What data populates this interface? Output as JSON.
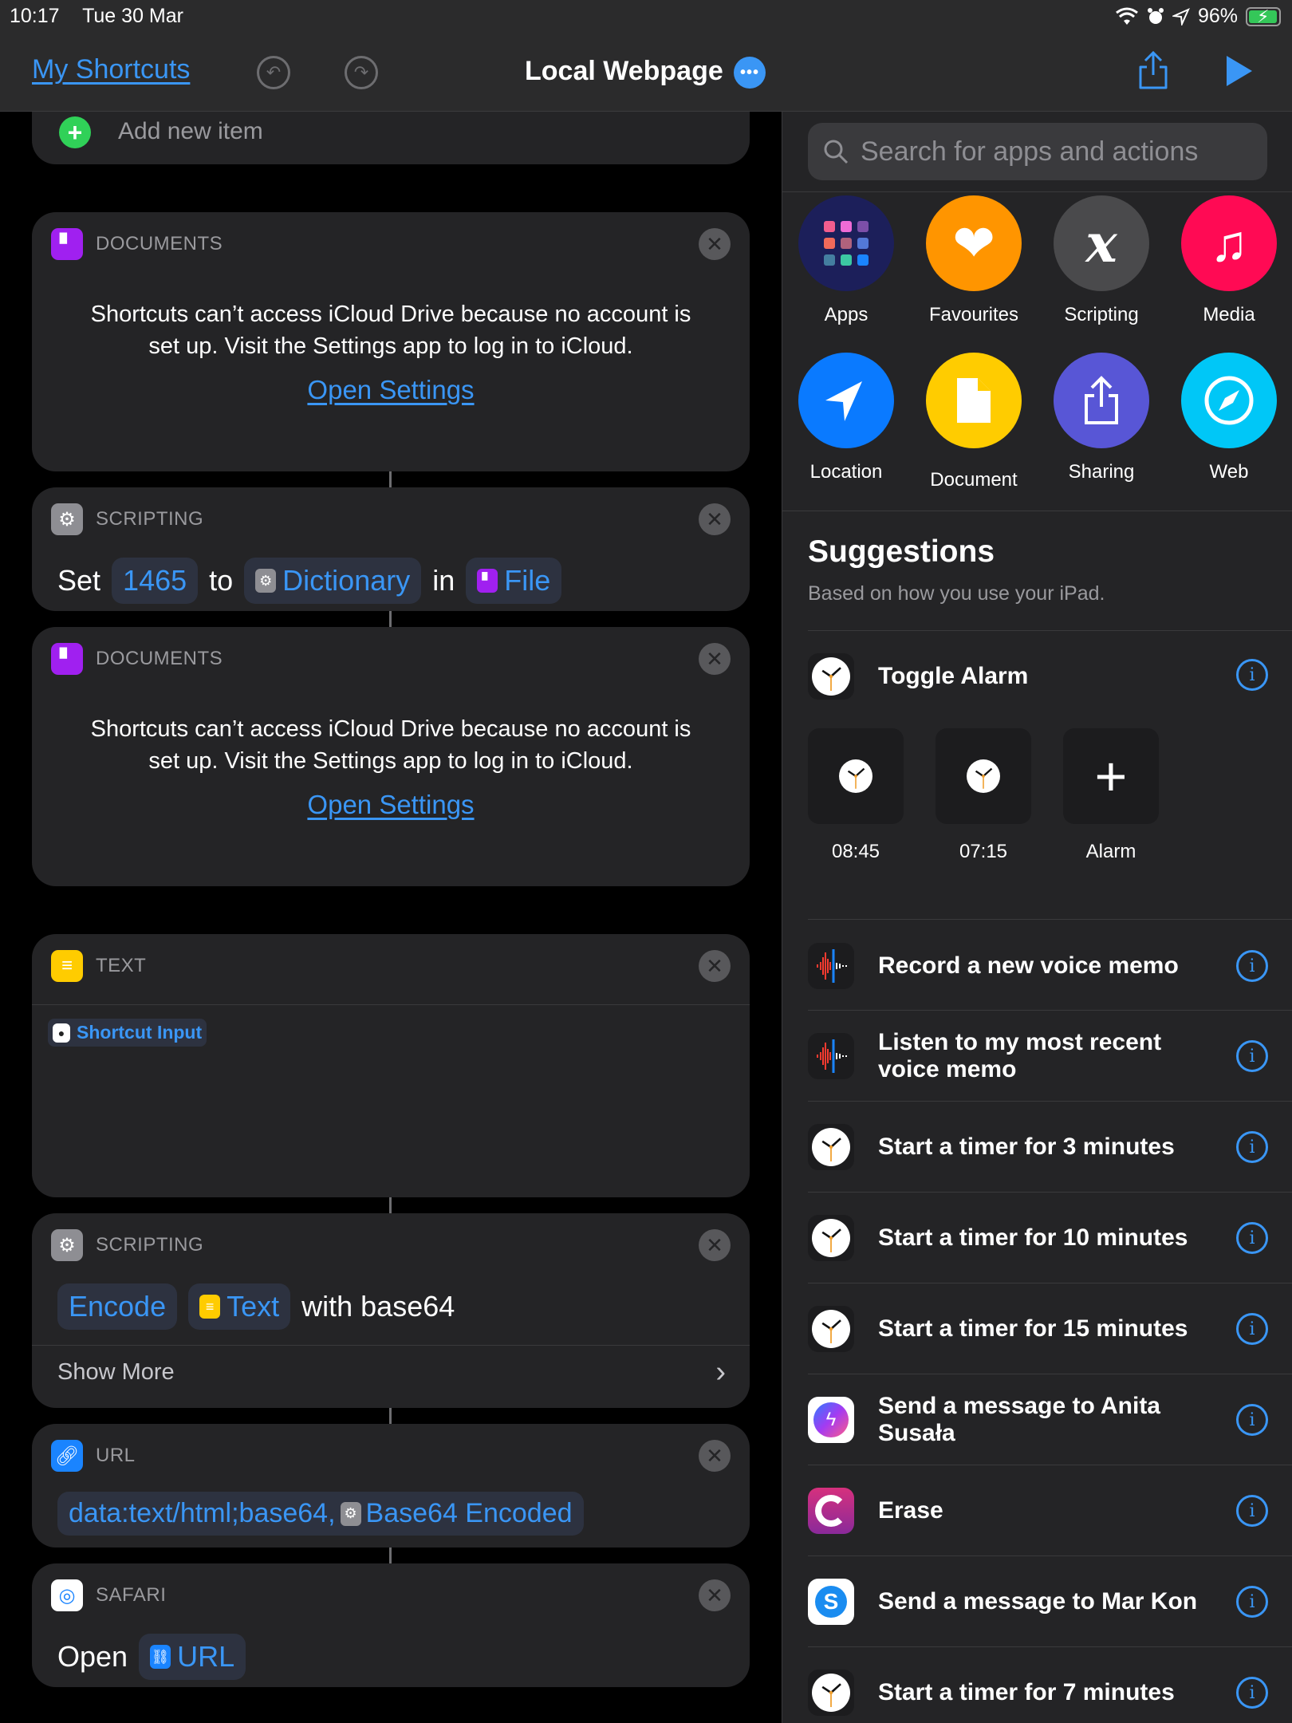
{
  "status_bar": {
    "time": "10:17",
    "date": "Tue 30 Mar",
    "battery": "96%",
    "battery_level": 0.96
  },
  "nav": {
    "back_label": "My Shortcuts",
    "title": "Local Webpage",
    "more_label": "•••",
    "undo_icon": "undo-icon",
    "redo_icon": "redo-icon",
    "share_icon": "share-icon",
    "play_icon": "play-icon"
  },
  "editor": {
    "add_new_item": "Add new item",
    "cards": [
      {
        "kind": "DOCUMENTS",
        "message": "Shortcuts can’t access iCloud Drive because no account is set up. Visit the Settings app to log in to iCloud.",
        "link": "Open Settings"
      },
      {
        "kind": "SCRIPTING",
        "words": {
          "set": "Set",
          "key": "1465",
          "to": "to",
          "dictionary": "Dictionary",
          "in": "in",
          "file": "File"
        }
      },
      {
        "kind": "DOCUMENTS",
        "message": "Shortcuts can’t access iCloud Drive because no account is set up. Visit the Settings app to log in to iCloud.",
        "link": "Open Settings"
      },
      {
        "kind": "TEXT",
        "token": "Shortcut Input"
      },
      {
        "kind": "SCRIPTING",
        "words": {
          "encode": "Encode",
          "text": "Text",
          "rest": "with base64"
        },
        "show_more": "Show More"
      },
      {
        "kind": "URL",
        "url_prefix": "data:text/html;base64,",
        "url_token": "Base64 Encoded"
      },
      {
        "kind": "SAFARI",
        "words": {
          "open": "Open",
          "url": "URL"
        }
      }
    ]
  },
  "panel": {
    "search_placeholder": "Search for apps and actions",
    "categories": [
      {
        "label": "Apps",
        "color": "#1c1f5a"
      },
      {
        "label": "Favourites",
        "color": "#ff9500"
      },
      {
        "label": "Scripting",
        "color": "#4a4a4c"
      },
      {
        "label": "Media",
        "color": "#ff0a54"
      },
      {
        "label": "Location",
        "color": "#0a7aff"
      },
      {
        "label": "Document",
        "color": "#ffcc00"
      },
      {
        "label": "Sharing",
        "color": "#5856d6"
      },
      {
        "label": "Web",
        "color": "#00c7f7"
      }
    ],
    "suggestions_title": "Suggestions",
    "suggestions_subtitle": "Based on how you use your iPad.",
    "toggle_alarm": {
      "label": "Toggle Alarm",
      "tiles": [
        "08:45",
        "07:15",
        "Alarm"
      ]
    },
    "items": [
      {
        "label": "Record a new voice memo",
        "icon": "voice-memos-icon"
      },
      {
        "label": "Listen to my most recent voice memo",
        "icon": "voice-memos-icon"
      },
      {
        "label": "Start a timer for 3 minutes",
        "icon": "clock-icon"
      },
      {
        "label": "Start a timer for 10 minutes",
        "icon": "clock-icon"
      },
      {
        "label": "Start a timer for 15 minutes",
        "icon": "clock-icon"
      },
      {
        "label": "Send a message to Anita Susała",
        "icon": "messenger-icon"
      },
      {
        "label": "Erase",
        "icon": "firefox-focus-icon"
      },
      {
        "label": "Send a message to Mar Kon",
        "icon": "skype-icon"
      },
      {
        "label": "Start a timer for 7 minutes",
        "icon": "clock-icon"
      }
    ]
  },
  "colors": {
    "accent": "#3a96f5",
    "card": "#242426",
    "background": "#000000"
  }
}
